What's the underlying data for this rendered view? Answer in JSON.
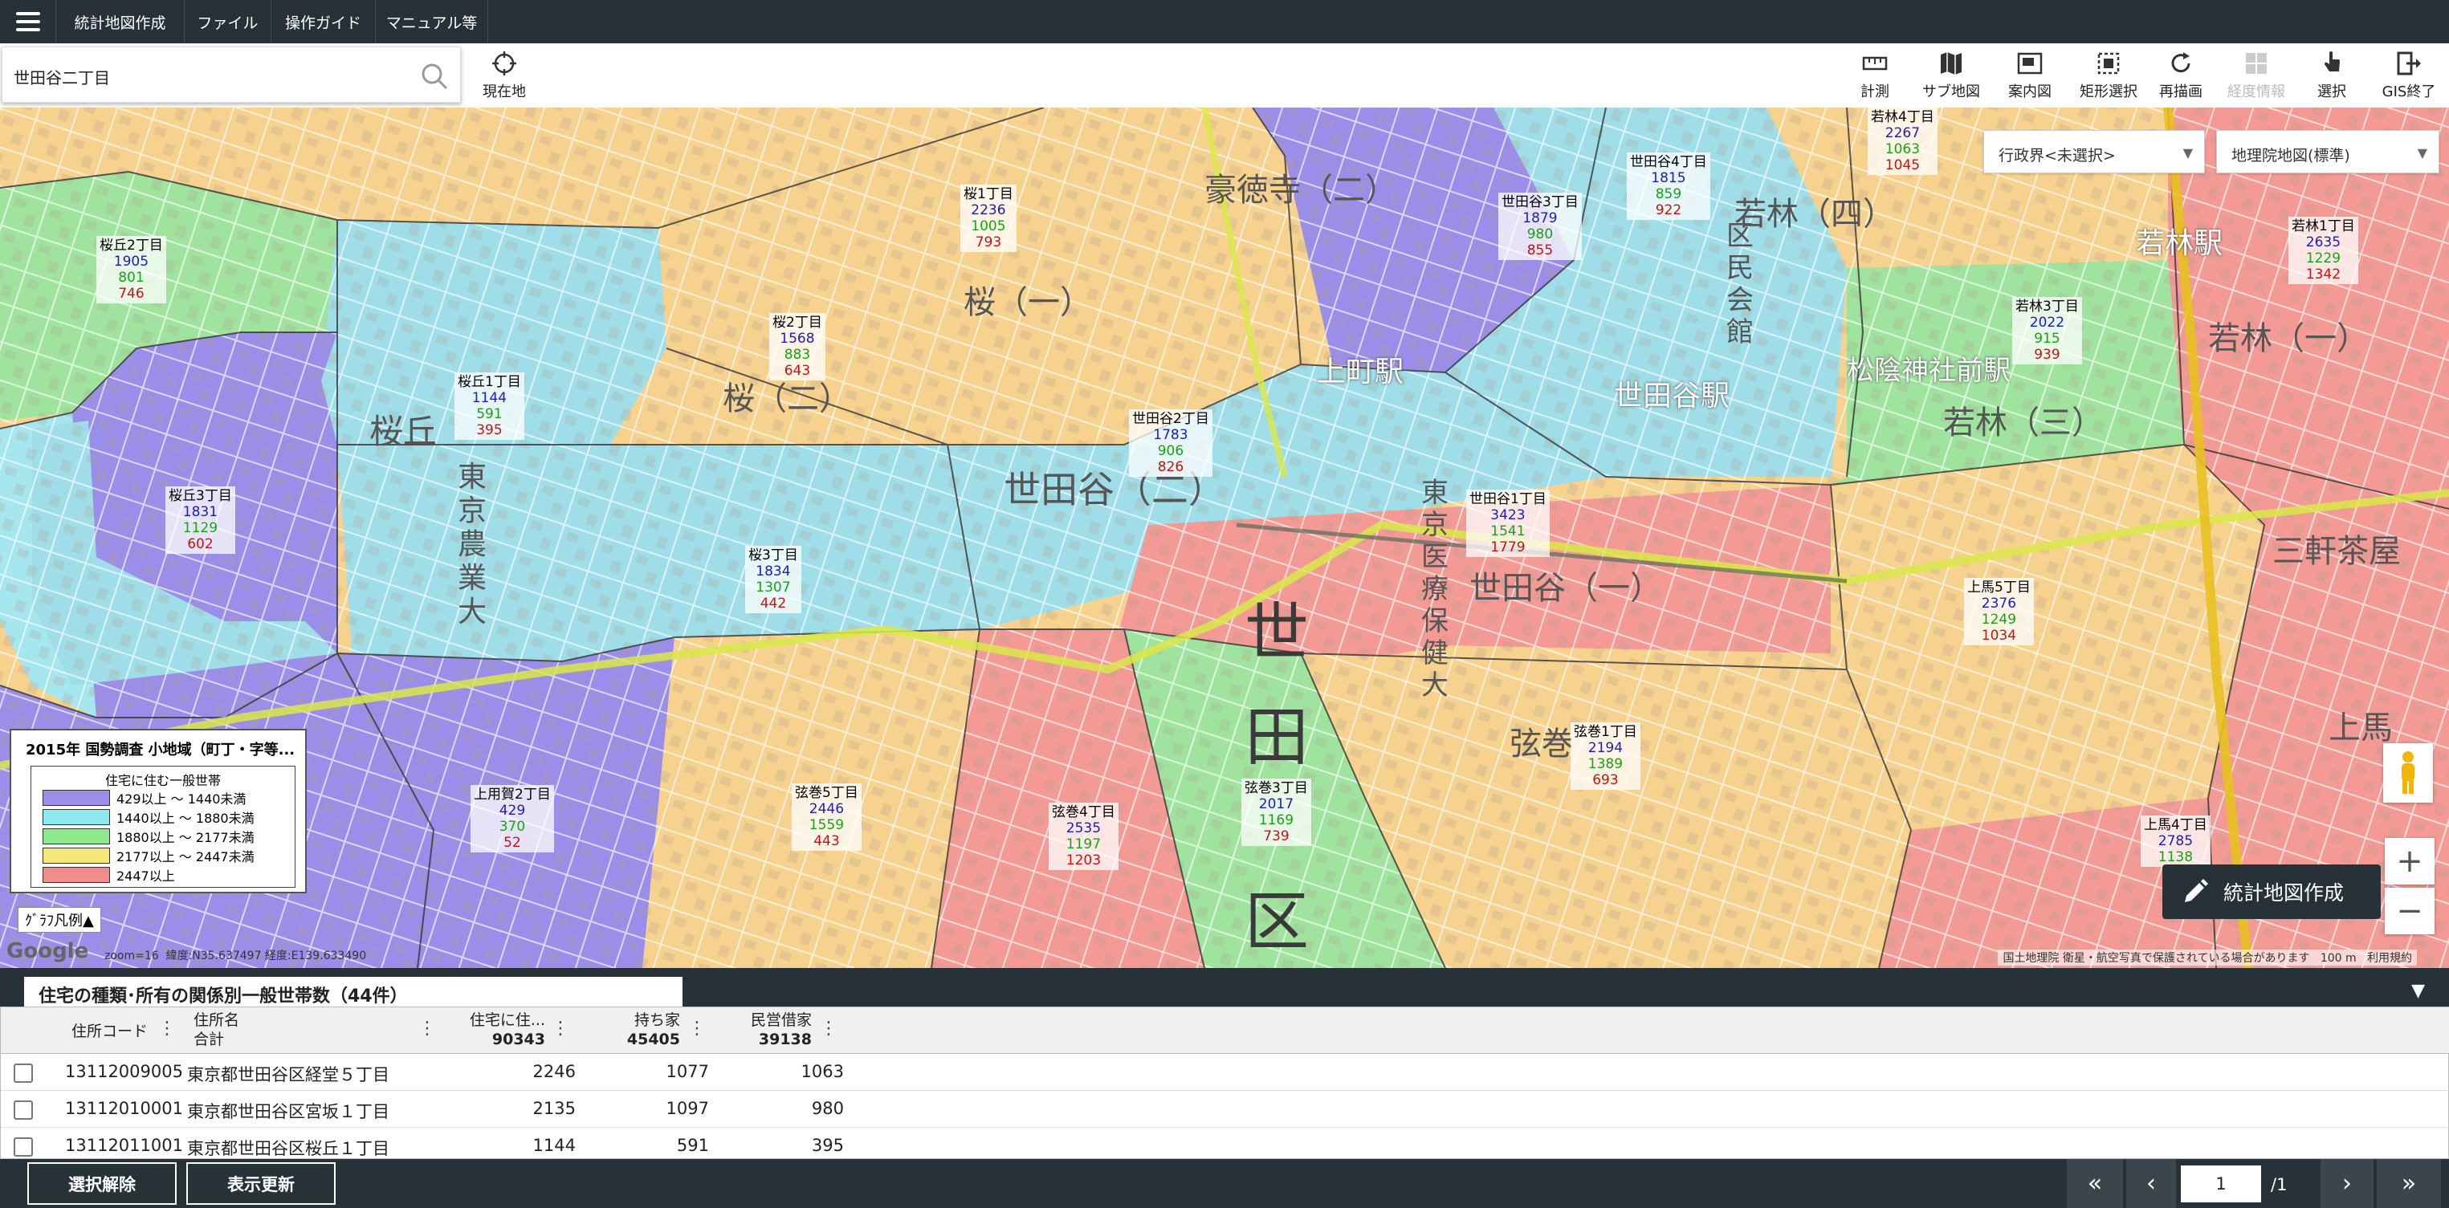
{
  "menu": {
    "items": [
      "統計地図作成",
      "ファイル",
      "操作ガイド",
      "マニュアル等"
    ]
  },
  "search": {
    "value": "世田谷二丁目",
    "current_location_label": "現在地"
  },
  "tools": [
    {
      "label": "計測",
      "icon": "ruler-icon",
      "enabled": true
    },
    {
      "label": "サブ地図",
      "icon": "map-icon",
      "enabled": true
    },
    {
      "label": "案内図",
      "icon": "overview-map-icon",
      "enabled": true
    },
    {
      "label": "矩形選択",
      "icon": "rect-select-icon",
      "enabled": true
    },
    {
      "label": "再描画",
      "icon": "refresh-icon",
      "enabled": true
    },
    {
      "label": "経度情報",
      "icon": "grid-info-icon",
      "enabled": false
    },
    {
      "label": "選択",
      "icon": "pointer-hand-icon",
      "enabled": true
    },
    {
      "label": "GIS終了",
      "icon": "exit-icon",
      "enabled": true
    }
  ],
  "map": {
    "boundary_select": "行政界<未選択>",
    "basemap_select": "地理院地図(標準)",
    "area_labels": [
      {
        "name": "桜丘2丁目",
        "v1": "1905",
        "v2": "801",
        "v3": "746"
      },
      {
        "name": "桜丘1丁目",
        "v1": "1144",
        "v2": "591",
        "v3": "395"
      },
      {
        "name": "桜丘3丁目",
        "v1": "1831",
        "v2": "1129",
        "v3": "602"
      },
      {
        "name": "桜2丁目",
        "v1": "1568",
        "v2": "883",
        "v3": "643"
      },
      {
        "name": "桜1丁目",
        "v1": "2236",
        "v2": "1005",
        "v3": "793"
      },
      {
        "name": "桜3丁目",
        "v1": "1834",
        "v2": "1307",
        "v3": "442"
      },
      {
        "name": "世田谷2丁目",
        "v1": "1783",
        "v2": "906",
        "v3": "826"
      },
      {
        "name": "世田谷3丁目",
        "v1": "1879",
        "v2": "980",
        "v3": "855"
      },
      {
        "name": "世田谷4丁目",
        "v1": "1815",
        "v2": "859",
        "v3": "922"
      },
      {
        "name": "世田谷1丁目",
        "v1": "3423",
        "v2": "1541",
        "v3": "1779"
      },
      {
        "name": "若林4丁目",
        "v1": "2267",
        "v2": "1063",
        "v3": "1045"
      },
      {
        "name": "若林1丁目",
        "v1": "2635",
        "v2": "1229",
        "v3": "1342"
      },
      {
        "name": "若林3丁目",
        "v1": "2022",
        "v2": "915",
        "v3": "939"
      },
      {
        "name": "上馬5丁目",
        "v1": "2376",
        "v2": "1249",
        "v3": "1034"
      },
      {
        "name": "弦巻1丁目",
        "v1": "2194",
        "v2": "1389",
        "v3": "693"
      },
      {
        "name": "弦巻3丁目",
        "v1": "2017",
        "v2": "1169",
        "v3": "739"
      },
      {
        "name": "弦巻4丁目",
        "v1": "2535",
        "v2": "1197",
        "v3": "1203"
      },
      {
        "name": "弦巻5丁目",
        "v1": "2446",
        "v2": "1559",
        "v3": "443"
      },
      {
        "name": "上用賀2丁目",
        "v1": "429",
        "v2": "370",
        "v3": "52"
      },
      {
        "name": "上馬4丁目",
        "v1": "2785",
        "v2": "1138",
        "v3": ""
      }
    ],
    "place_names": [
      "世田谷（二）",
      "世田谷（一）",
      "桜（一）",
      "桜（二）",
      "桜丘",
      "若林（一）",
      "若林（四）",
      "若林（三）",
      "三軒茶屋",
      "上馬",
      "弦巻",
      "区",
      "田",
      "世",
      "東京農業大",
      "東京医療保健大",
      "豪徳寺（二）",
      "区民会館",
      "世田谷駅",
      "若林駅",
      "松陰神社前駅",
      "上町駅"
    ],
    "zoom_text": "zoom=16",
    "coords_text": "緯度:N35.637497   経度:E139.633490",
    "attribution": "国土地理院   衛星・航空写真で保護されている場合があります",
    "scale_text": "100 m",
    "terms": "利用規約",
    "google": "Google",
    "create_button": "統計地図作成",
    "zoom_in": "+",
    "zoom_out": "−"
  },
  "legend": {
    "title": "2015年 国勢調査 小地域（町丁・字等...",
    "subtitle": "住宅に住む一般世帯",
    "toggle": "ｸﾞﾗﾌ凡例▲",
    "classes": [
      {
        "label": "429以上 ～ 1440未満",
        "color": "#9b8ee8"
      },
      {
        "label": "1440以上 ～ 1880未満",
        "color": "#8ee8f0"
      },
      {
        "label": "1880以上 ～ 2177未満",
        "color": "#8ee88e"
      },
      {
        "label": "2177以上 ～ 2447未満",
        "color": "#f5e878"
      },
      {
        "label": "2447以上",
        "color": "#f08c8c"
      }
    ]
  },
  "panel": {
    "title": "住宅の種類･所有の関係別一般世帯数（44件）",
    "columns": [
      {
        "label": "住所コード",
        "sub": ""
      },
      {
        "label": "住所名",
        "sub": "合計"
      },
      {
        "label": "住宅に住...",
        "sub": "90343"
      },
      {
        "label": "持ち家",
        "sub": "45405"
      },
      {
        "label": "民営借家",
        "sub": "39138"
      }
    ],
    "rows": [
      {
        "code": "13112009005",
        "name": "東京都世田谷区経堂５丁目",
        "c1": "2246",
        "c2": "1077",
        "c3": "1063"
      },
      {
        "code": "13112010001",
        "name": "東京都世田谷区宮坂１丁目",
        "c1": "2135",
        "c2": "1097",
        "c3": "980"
      },
      {
        "code": "13112011001",
        "name": "東京都世田谷区桜丘１丁目",
        "c1": "1144",
        "c2": "591",
        "c3": "395"
      }
    ]
  },
  "footer": {
    "clear_button": "選択解除",
    "refresh_button": "表示更新",
    "first": "«",
    "prev": "‹",
    "page": "1",
    "page_count": "/1",
    "next": "›",
    "last": "»"
  }
}
